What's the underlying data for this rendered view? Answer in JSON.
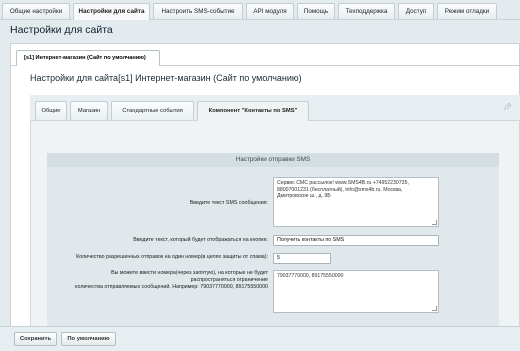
{
  "top_tabs": [
    "Общие настройки",
    "Настройки для сайта",
    "Настроить SMS-событие",
    "API модуля",
    "Помощь",
    "Техподдержка",
    "Доступ",
    "Режим отладки"
  ],
  "page_title": "Настройки для сайта",
  "site_tab": "[s1] Интернет-магазин (Сайт по умолчанию)",
  "site_heading": "Настройки для сайта[s1] Интернет-магазин (Сайт по умолчанию)",
  "inner_tabs": [
    "Общие",
    "Магазин",
    "Стандартные события",
    "Компонент \"Контакты по SMS\""
  ],
  "group_title": "Настройки отправки SMS",
  "fields": {
    "sms_text_label": "Введите текст SMS сообщения:",
    "sms_text_value": "Сервис СМС рассылок! www.SMS4B.ru +74952230735, 88007001231 (бесплатный), info@sms4b.ru. Москва, Дмитровское ш., д. 9Б",
    "button_text_label": "Введите текст, который будет отображаться на кнопке:",
    "button_text_value": "Получить контакты по SMS",
    "limit_label": "Количество разрешенных отправок на один номер(в целях защиты от спама):",
    "limit_value": "5",
    "numbers_label_1": "Вы можете ввести номера(через запятую), на которые не будет",
    "numbers_label_2": "распространяться ограничение",
    "numbers_label_3": "количества отправляемых сообщений. Например: 79037770000, 89175550000",
    "numbers_value": "79037770000, 89175550000"
  },
  "footer": {
    "save": "Сохранить",
    "default": "По умолчанию"
  }
}
